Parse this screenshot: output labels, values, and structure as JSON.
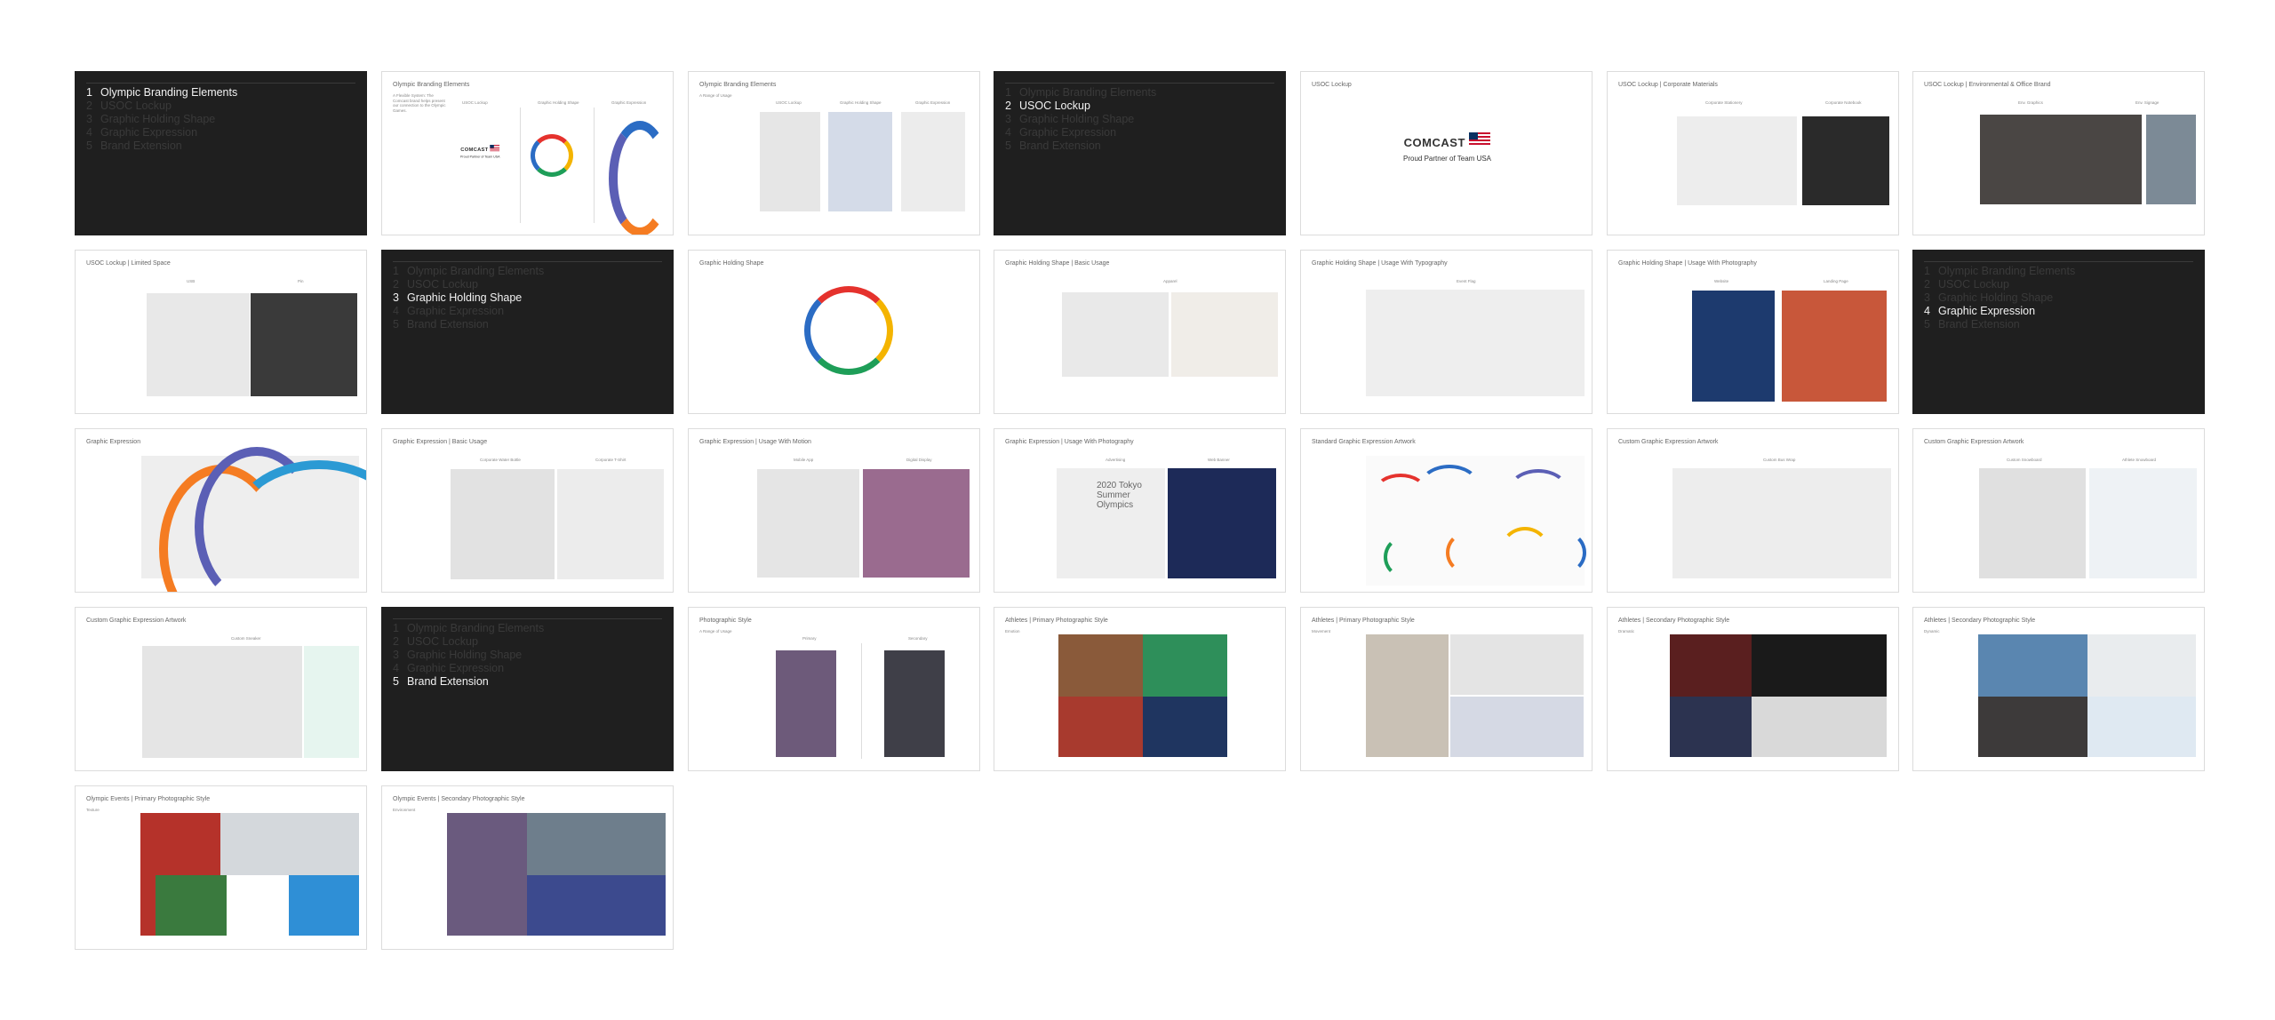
{
  "sections": [
    "Olympic Branding Elements",
    "USOC Lockup",
    "Graphic Holding Shape",
    "Graphic Expression",
    "Brand Extension"
  ],
  "brand": {
    "wordmark": "COMCAST",
    "caption": "Proud Partner of Team USA"
  },
  "colors": {
    "dark": "#1f1f1f",
    "red": "#e5322d",
    "orange": "#f57c22",
    "yellow": "#f4b400",
    "green": "#1e9e58",
    "blue": "#2b6cc4",
    "purple": "#5b5fb5"
  },
  "slides": [
    {
      "title": "",
      "active": 1
    },
    {
      "title": "Olympic Branding Elements",
      "body": "A Flexible System: The Comcast brand helps present our connection to the Olympic Games.",
      "labels": [
        "USOC Lockup",
        "Graphic Holding Shape",
        "Graphic Expression"
      ]
    },
    {
      "title": "Olympic Branding Elements",
      "body": "A Range of Usage",
      "labels": [
        "USOC Lockup",
        "Graphic Holding Shape",
        "Graphic Expression"
      ]
    },
    {
      "title": "",
      "active": 2
    },
    {
      "title": "USOC Lockup",
      "body": ""
    },
    {
      "title": "USOC Lockup | Corporate Materials",
      "body": "",
      "labels": [
        "Corporate Stationery",
        "Corporate Notebook"
      ]
    },
    {
      "title": "USOC Lockup | Environmental & Office Brand",
      "body": "",
      "labels": [
        "Env. Graphics",
        "Env. Signage"
      ]
    },
    {
      "title": "USOC Lockup | Limited Space",
      "body": "",
      "labels": [
        "USB",
        "Pin"
      ]
    },
    {
      "title": "",
      "active": 3
    },
    {
      "title": "Graphic Holding Shape",
      "body": ""
    },
    {
      "title": "Graphic Holding Shape | Basic Usage",
      "body": "",
      "labels": [
        "Apparel"
      ]
    },
    {
      "title": "Graphic Holding Shape | Usage With Typography",
      "body": "",
      "labels": [
        "Event Flag"
      ]
    },
    {
      "title": "Graphic Holding Shape | Usage With Photography",
      "body": "",
      "labels": [
        "Website",
        "Landing Page"
      ]
    },
    {
      "title": "",
      "active": 4
    },
    {
      "title": "Graphic Expression",
      "body": ""
    },
    {
      "title": "Graphic Expression | Basic Usage",
      "body": "",
      "labels": [
        "Corporate Water Bottle",
        "Corporate T-Shirt"
      ]
    },
    {
      "title": "Graphic Expression | Usage With Motion",
      "body": "",
      "labels": [
        "Mobile App",
        "Digital Display"
      ]
    },
    {
      "title": "Graphic Expression | Usage With Photography",
      "body": "",
      "labels": [
        "Advertising",
        "Web Banner"
      ]
    },
    {
      "title": "Standard Graphic Expression Artwork",
      "body": ""
    },
    {
      "title": "Custom Graphic Expression Artwork",
      "body": "",
      "labels": [
        "Custom Bus Wrap"
      ]
    },
    {
      "title": "Custom Graphic Expression Artwork",
      "body": "",
      "labels": [
        "Custom Snowboard",
        "Athlete Snowboard"
      ]
    },
    {
      "title": "Custom Graphic Expression Artwork",
      "body": "",
      "labels": [
        "Custom Sneaker"
      ]
    },
    {
      "title": "",
      "active": 5
    },
    {
      "title": "Photographic Style",
      "body": "A Range of Usage",
      "labels": [
        "Primary",
        "Secondary"
      ]
    },
    {
      "title": "Athletes | Primary Photographic Style",
      "body": "Emotion"
    },
    {
      "title": "Athletes | Primary Photographic Style",
      "body": "Movement"
    },
    {
      "title": "Athletes | Secondary Photographic Style",
      "body": "Dramatic"
    },
    {
      "title": "Athletes | Secondary Photographic Style",
      "body": "Dynamic"
    },
    {
      "title": "Olympic Events | Primary Photographic Style",
      "body": "Texture"
    },
    {
      "title": "Olympic Events | Secondary Photographic Style",
      "body": "Environment"
    }
  ],
  "flag_text": "2020 Tokyo Summer Olympics"
}
